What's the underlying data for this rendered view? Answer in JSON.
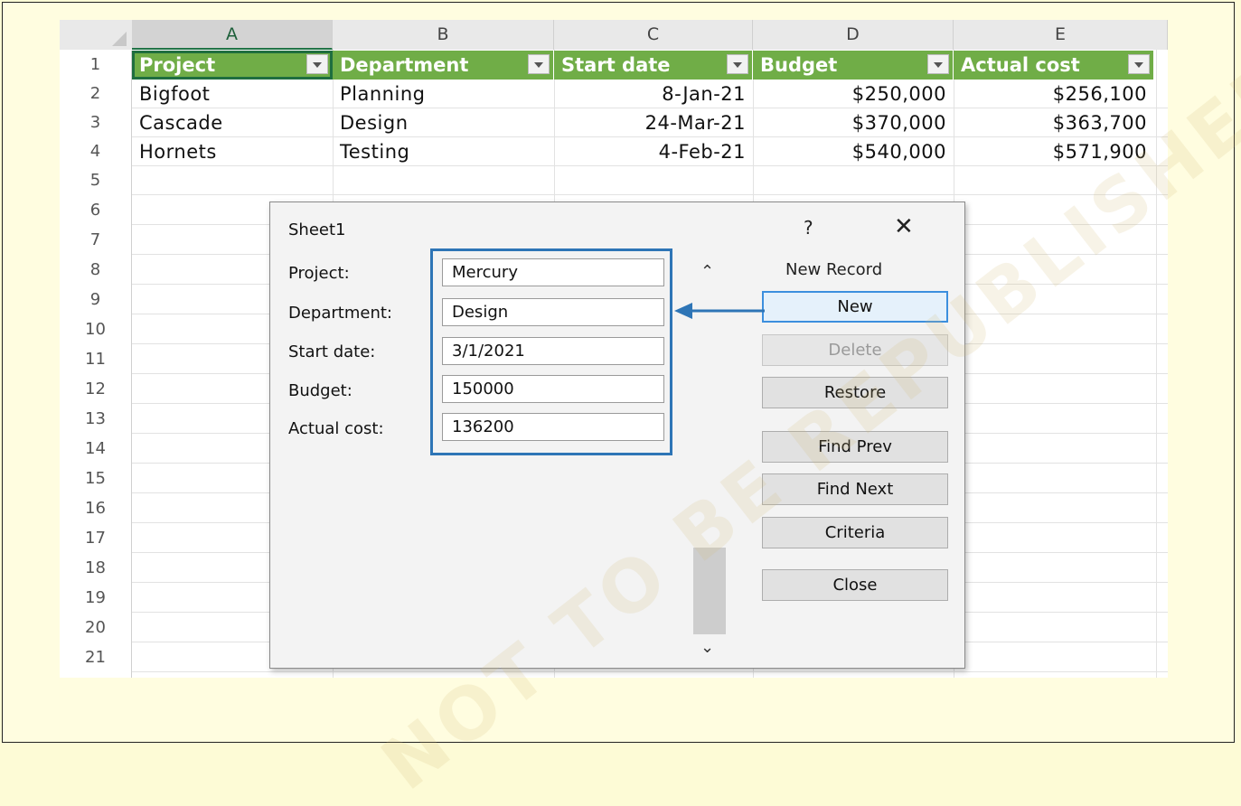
{
  "columns": [
    "A",
    "B",
    "C",
    "D",
    "E"
  ],
  "rows": [
    "1",
    "2",
    "3",
    "4",
    "5",
    "6",
    "7",
    "8",
    "9",
    "10",
    "11",
    "12",
    "13",
    "14",
    "15",
    "16",
    "17",
    "18",
    "19",
    "20",
    "21"
  ],
  "table": {
    "headers": [
      "Project",
      "Department",
      "Start date",
      "Budget",
      "Actual cost"
    ],
    "data": [
      [
        "Bigfoot",
        "Planning",
        "8-Jan-21",
        "$250,000",
        "$256,100"
      ],
      [
        "Cascade",
        "Design",
        "24-Mar-21",
        "$370,000",
        "$363,700"
      ],
      [
        "Hornets",
        "Testing",
        "4-Feb-21",
        "$540,000",
        "$571,900"
      ]
    ]
  },
  "dialog": {
    "title": "Sheet1",
    "help": "?",
    "close_glyph": "✕",
    "status": "New Record",
    "fields": [
      {
        "label": "Project:",
        "value": "Mercury"
      },
      {
        "label": "Department:",
        "value": "Design"
      },
      {
        "label": "Start date:",
        "value": "3/1/2021"
      },
      {
        "label": "Budget:",
        "value": "150000"
      },
      {
        "label": "Actual cost:",
        "value": "136200"
      }
    ],
    "buttons": {
      "new": "New",
      "delete": "Delete",
      "restore": "Restore",
      "find_prev": "Find Prev",
      "find_next": "Find Next",
      "criteria": "Criteria",
      "close": "Close"
    },
    "scroll_up": "⌃",
    "scroll_down": "⌄"
  },
  "watermark": "NOT TO BE REPUBLISHED",
  "colors": {
    "header_green": "#70ad47",
    "accent_blue": "#2e75b6"
  }
}
